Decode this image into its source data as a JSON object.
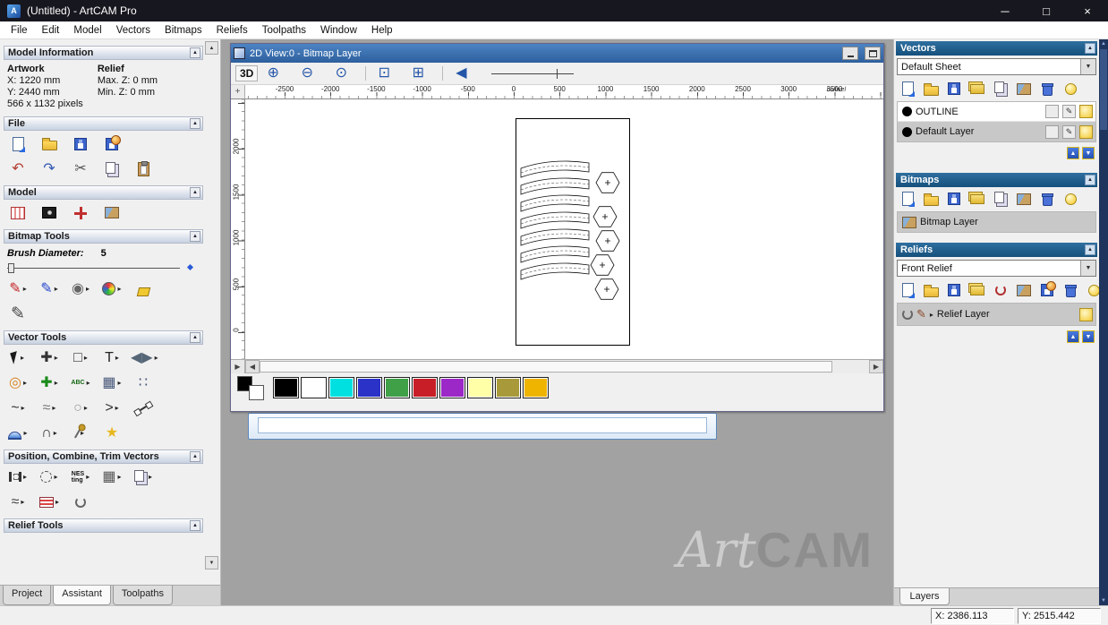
{
  "titlebar": {
    "title": "(Untitled) - ArtCAM Pro",
    "controls": {
      "min": "─",
      "max": "□",
      "close": "×"
    }
  },
  "menu": {
    "items": [
      "File",
      "Edit",
      "Model",
      "Vectors",
      "Bitmaps",
      "Reliefs",
      "Toolpaths",
      "Window",
      "Help"
    ]
  },
  "left_panel": {
    "model_information": {
      "header": "Model Information",
      "artwork_label": "Artwork",
      "relief_label": "Relief",
      "artwork_x": "X: 1220 mm",
      "artwork_y": "Y: 2440 mm",
      "relief_max": "Max. Z: 0 mm",
      "relief_min": "Min. Z: 0 mm",
      "pixels": "566 x 1132 pixels"
    },
    "file_header": "File",
    "model_header": "Model",
    "bitmap_tools_header": "Bitmap Tools",
    "brush_diameter_label": "Brush Diameter:",
    "brush_diameter_value": "5",
    "vector_tools_header": "Vector Tools",
    "position_header": "Position, Combine, Trim Vectors",
    "relief_tools_header": "Relief Tools",
    "tabs": [
      "Project",
      "Assistant",
      "Toolpaths"
    ],
    "active_tab": "Assistant"
  },
  "view2d": {
    "title": "2D View:0 - Bitmap Layer",
    "toolbar_3d": "3D",
    "ruler_h_labels": [
      "-2500",
      "-2000",
      "-1500",
      "-1000",
      "-500",
      "0",
      "500",
      "1000",
      "1500",
      "2000",
      "2500",
      "3000",
      "3500"
    ],
    "ruler_v_labels": [
      "2000",
      "1500",
      "1000",
      "500",
      "0"
    ],
    "ruler_end_label": "nullivel",
    "palette_colors": [
      "#000000",
      "#ffffff",
      "#00e0e0",
      "#2a32c8",
      "#3fa048",
      "#c81e28",
      "#9c28c8",
      "#ffffa8",
      "#a89a3a",
      "#eeb400"
    ]
  },
  "right_panel": {
    "vectors": {
      "header": "Vectors",
      "sheet": "Default Sheet",
      "layers": [
        {
          "name": "OUTLINE"
        },
        {
          "name": "Default Layer"
        }
      ]
    },
    "bitmaps": {
      "header": "Bitmaps",
      "layers": [
        {
          "name": "Bitmap Layer"
        }
      ]
    },
    "reliefs": {
      "header": "Reliefs",
      "selected": "Front Relief",
      "layers": [
        {
          "name": "Relief Layer"
        }
      ]
    },
    "bottom_tab": "Layers"
  },
  "statusbar": {
    "x": "X: 2386.113",
    "y": "Y: 2515.442"
  },
  "watermark": {
    "part1": "Art",
    "part2": "CAM"
  },
  "icons": {
    "flyout": "▸"
  },
  "icon_rows": {
    "file1": [
      {
        "n": "new-model-icon",
        "k": "page"
      },
      {
        "n": "open-model-icon",
        "k": "folder"
      },
      {
        "n": "save-model-icon",
        "k": "disk"
      },
      {
        "n": "export-model-icon",
        "k": "diskglobe"
      }
    ],
    "file2": [
      {
        "n": "undo-icon",
        "g": "↶",
        "c": "#b23b2e"
      },
      {
        "n": "redo-icon",
        "g": "↷",
        "c": "#2e56b2"
      },
      {
        "n": "cut-icon",
        "g": "✂",
        "c": "#555555"
      },
      {
        "n": "copy-icon",
        "k": "copy"
      },
      {
        "n": "paste-icon",
        "k": "paste"
      }
    ],
    "model1": [
      {
        "n": "set-model-size-icon",
        "k": "modelsize"
      },
      {
        "n": "model-lighting-icon",
        "k": "lighting"
      },
      {
        "n": "set-origin-icon",
        "k": "redplus"
      },
      {
        "n": "greyscale-image-icon",
        "k": "picture"
      }
    ],
    "bitmap1": [
      {
        "n": "paint-icon",
        "g": "✎",
        "c": "#c22222",
        "fly": 1
      },
      {
        "n": "draw-icon",
        "g": "✎",
        "c": "#2244cc",
        "fly": 1
      },
      {
        "n": "colour-picker-icon",
        "g": "◉",
        "c": "#666666",
        "fly": 1
      },
      {
        "n": "colour-palette-icon",
        "k": "palette",
        "fly": 1
      },
      {
        "n": "flood-fill-icon",
        "k": "bucket"
      }
    ],
    "bitmap2": [
      {
        "n": "draw-pencil-icon",
        "g": "✎",
        "c": "#444444",
        "big": 1
      }
    ],
    "vector1": [
      {
        "n": "select-vectors-icon",
        "k": "cursor",
        "fly": 1
      },
      {
        "n": "transform-vectors-icon",
        "g": "✚",
        "c": "#333333",
        "fly": 1
      },
      {
        "n": "rectangle-tool-icon",
        "g": "□",
        "c": "#333333",
        "fly": 1
      },
      {
        "n": "text-tool-icon",
        "g": "T",
        "c": "#222222",
        "fly": 1
      },
      {
        "n": "mirror-tool-icon",
        "g": "◀▶",
        "c": "#556677",
        "fly": 1
      }
    ],
    "vector2": [
      {
        "n": "offset-tool-icon",
        "g": "◎",
        "c": "#d4821e",
        "fly": 1
      },
      {
        "n": "create-polyline-icon",
        "g": "✚",
        "c": "#1a8a1a",
        "fly": 1
      },
      {
        "n": "text-on-curve-icon",
        "t": "ABC",
        "c": "#116611",
        "fly": 1
      },
      {
        "n": "mesh-tool-icon",
        "g": "▦",
        "c": "#445577",
        "fly": 1
      },
      {
        "n": "point-cloud-icon",
        "g": "∷",
        "c": "#445577"
      }
    ],
    "vector3": [
      {
        "n": "fit-curve-icon",
        "g": "~",
        "c": "#333333",
        "fly": 1
      },
      {
        "n": "smooth-polyline-icon",
        "g": "≈",
        "c": "#777777",
        "fly": 1
      },
      {
        "n": "dashed-circle-icon",
        "g": "○",
        "c": "#999999",
        "fly": 1
      },
      {
        "n": "polyline-tool-icon",
        "g": ">",
        "c": "#333333",
        "fly": 1
      },
      {
        "n": "node-edit-icon",
        "k": "node"
      }
    ],
    "vector4": [
      {
        "n": "dome-tool-icon",
        "k": "dome",
        "fly": 1
      },
      {
        "n": "arc-tool-icon",
        "g": "∩",
        "c": "#333333",
        "fly": 1
      },
      {
        "n": "measure-tool-icon",
        "k": "pin",
        "fly": 1
      },
      {
        "n": "star-tool-icon",
        "g": "★",
        "c": "#e8b820"
      }
    ],
    "pos1": [
      {
        "n": "align-vectors-icon",
        "k": "align",
        "fly": 1
      },
      {
        "n": "rotate-copy-icon",
        "k": "rotdash",
        "fly": 1
      },
      {
        "n": "nesting-icon",
        "t": "NES\nting",
        "c": "#111111",
        "fly": 1
      },
      {
        "n": "block-copy-icon",
        "g": "▦",
        "c": "#555555",
        "fly": 1
      },
      {
        "n": "paste-along-curve-icon",
        "k": "copy",
        "fly": 1
      }
    ],
    "pos2": [
      {
        "n": "weld-vectors-icon",
        "g": "≈",
        "c": "#444444",
        "fly": 1
      },
      {
        "n": "vector-texture-icon",
        "k": "stamp",
        "fly": 1
      },
      {
        "n": "spiral-tool-icon",
        "k": "spiral"
      }
    ],
    "view_tb": [
      {
        "n": "zoom-in-icon",
        "g": "⊕",
        "c": "#2456a8"
      },
      {
        "n": "zoom-out-icon",
        "g": "⊖",
        "c": "#2456a8"
      },
      {
        "n": "zoom-100-icon",
        "g": "⊙",
        "c": "#2456a8"
      },
      {
        "sep": 1
      },
      {
        "n": "zoom-object-icon",
        "g": "⊡",
        "c": "#2456a8"
      },
      {
        "n": "zoom-window-icon",
        "g": "⊞",
        "c": "#2456a8"
      },
      {
        "sep": 1
      },
      {
        "n": "pan-view-icon",
        "g": "◀",
        "c": "#2456a8"
      }
    ],
    "vectors_tb": [
      {
        "n": "new-vector-layer-icon",
        "k": "page"
      },
      {
        "n": "open-vector-layer-icon",
        "k": "folder"
      },
      {
        "n": "save-vector-layer-icon",
        "k": "disk"
      },
      {
        "n": "all-sheets-icon",
        "k": "stack"
      },
      {
        "n": "copy-sheet-icon",
        "k": "copy"
      },
      {
        "n": "merge-layers-icon",
        "k": "picture"
      },
      {
        "n": "delete-layer-icon",
        "k": "trash"
      },
      {
        "n": "toggle-all-visibility-icon",
        "k": "bulb"
      }
    ],
    "bitmaps_tb": [
      {
        "n": "new-bitmap-layer-icon",
        "k": "page"
      },
      {
        "n": "open-bitmap-icon",
        "k": "folder"
      },
      {
        "n": "save-bitmap-icon",
        "k": "disk"
      },
      {
        "n": "bitmap-stack-icon",
        "k": "stack"
      },
      {
        "n": "copy-bitmap-icon",
        "k": "copy"
      },
      {
        "n": "merge-bitmap-icon",
        "k": "picture"
      },
      {
        "n": "delete-bitmap-layer-icon",
        "k": "trash"
      },
      {
        "n": "toggle-bitmap-visibility-icon",
        "k": "bulb"
      }
    ],
    "reliefs_tb": [
      {
        "n": "new-relief-layer-icon",
        "k": "page"
      },
      {
        "n": "open-relief-icon",
        "k": "folder"
      },
      {
        "n": "save-relief-icon",
        "k": "disk"
      },
      {
        "n": "relief-stack-icon",
        "k": "stack"
      },
      {
        "n": "smooth-relief-icon",
        "k": "spiralred"
      },
      {
        "n": "merge-relief-icon",
        "k": "picture"
      },
      {
        "n": "calculate-relief-icon",
        "k": "diskglobe"
      },
      {
        "n": "delete-relief-layer-icon",
        "k": "trash"
      },
      {
        "n": "toggle-relief-visibility-icon",
        "k": "bulb"
      }
    ]
  }
}
